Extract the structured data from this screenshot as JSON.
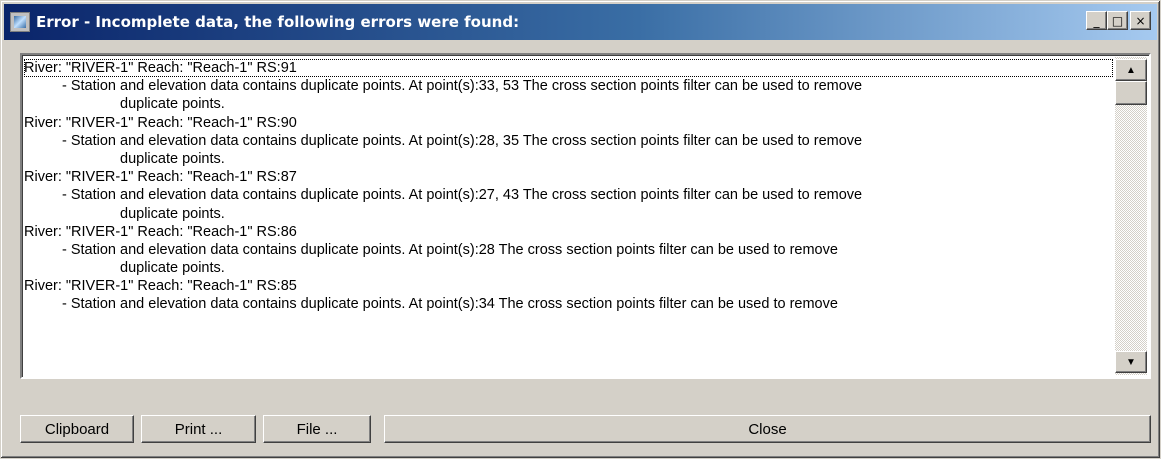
{
  "window": {
    "title": "Error - Incomplete data, the following errors were found:",
    "minimize_glyph": "_",
    "maximize_glyph": "□",
    "close_glyph": "×"
  },
  "errors": [
    {
      "header": "River: \"RIVER-1\"   Reach: \"Reach-1\"   RS:91",
      "message": "- Station and elevation data contains duplicate points. At point(s):33, 53  The cross section points filter can be used to remove",
      "continuation": "duplicate points."
    },
    {
      "header": "River: \"RIVER-1\"   Reach: \"Reach-1\"   RS:90",
      "message": "- Station and elevation data contains duplicate points. At point(s):28, 35  The cross section points filter can be used to remove",
      "continuation": "duplicate points."
    },
    {
      "header": "River: \"RIVER-1\"   Reach: \"Reach-1\"   RS:87",
      "message": "- Station and elevation data contains duplicate points. At point(s):27, 43  The cross section points filter can be used to remove",
      "continuation": "duplicate points."
    },
    {
      "header": "River: \"RIVER-1\"   Reach: \"Reach-1\"   RS:86",
      "message": "- Station and elevation data contains duplicate points. At point(s):28  The cross section points filter can be used to remove",
      "continuation": "duplicate points."
    },
    {
      "header": "River: \"RIVER-1\"   Reach: \"Reach-1\"   RS:85",
      "message": "- Station and elevation data contains duplicate points. At point(s):34  The cross section points filter can be used to remove",
      "continuation": ""
    }
  ],
  "scrollbar": {
    "up_glyph": "▲",
    "down_glyph": "▼"
  },
  "buttons": {
    "clipboard": "Clipboard",
    "print": "Print ...",
    "file": "File ...",
    "close": "Close"
  }
}
